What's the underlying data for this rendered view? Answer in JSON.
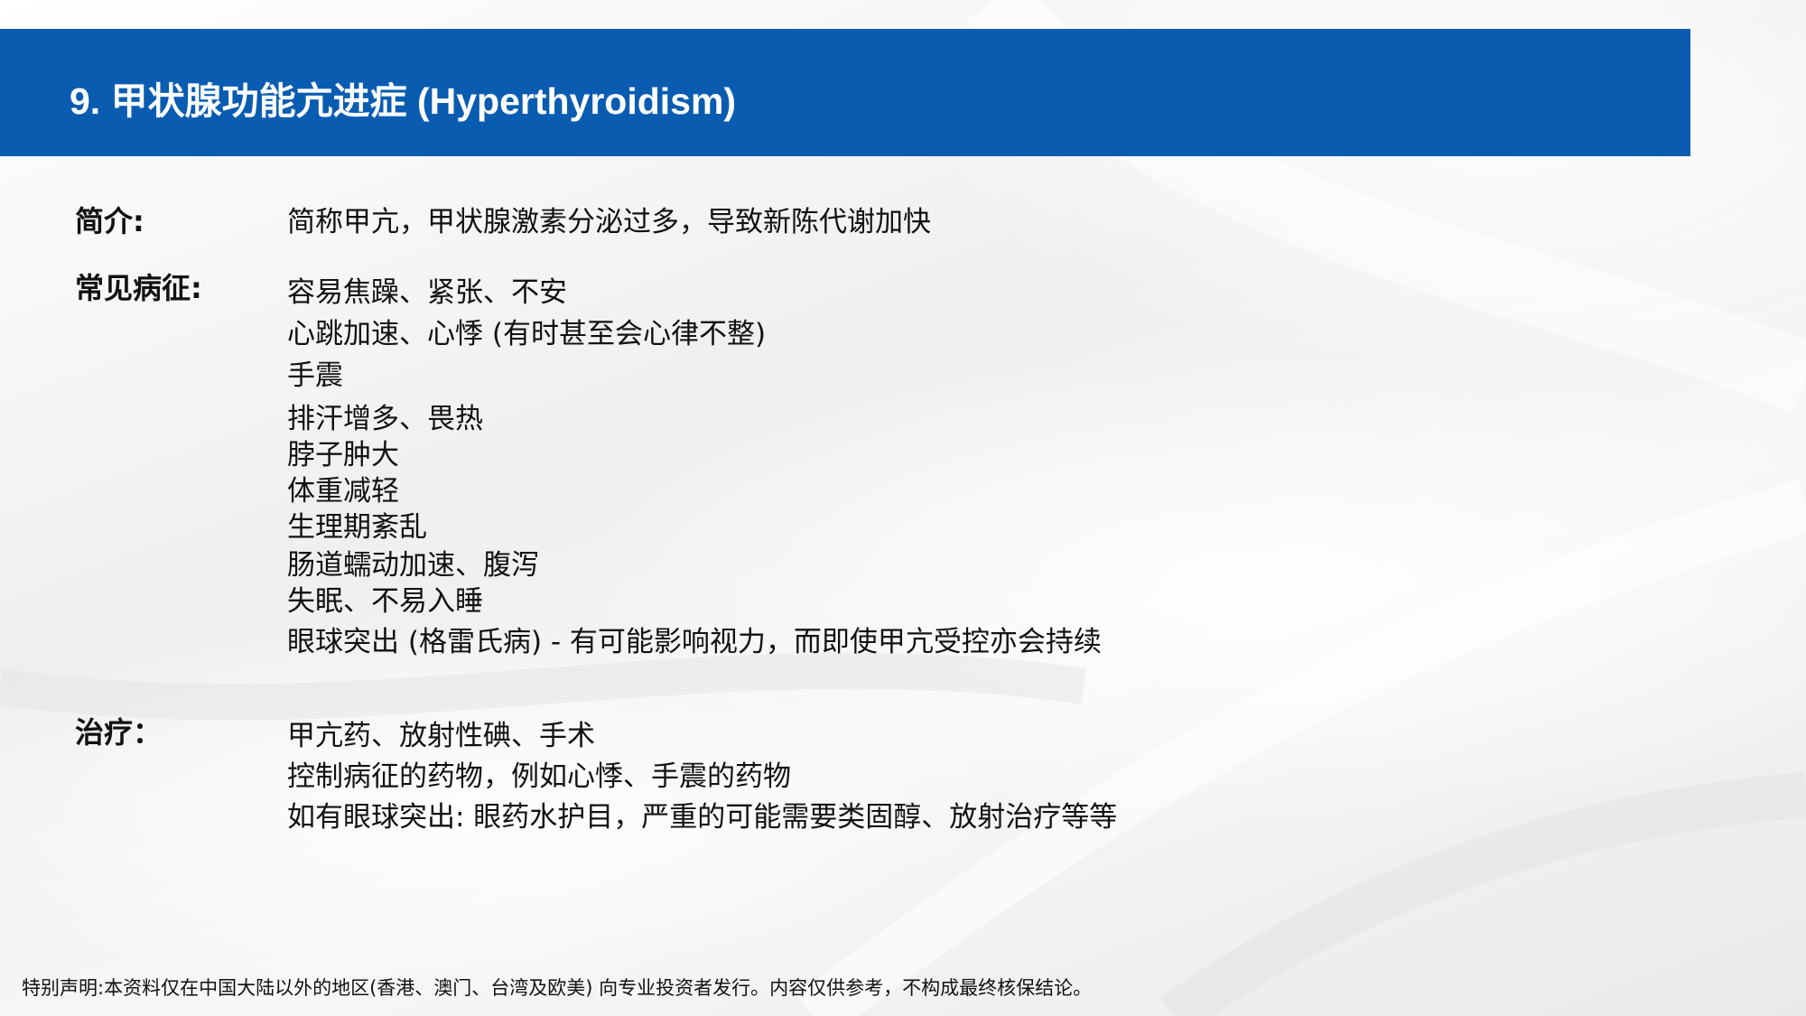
{
  "slide": {
    "title": "9. 甲状腺功能亢进症 (Hyperthyroidism)",
    "intro": {
      "label": "简介:",
      "text": "简称甲亢，甲状腺激素分泌过多，导致新陈代谢加快"
    },
    "symptoms": {
      "label": "常见病征:",
      "items": [
        "容易焦躁、紧张、不安",
        "心跳加速、心悸 (有时甚至会心律不整)",
        "手震",
        "排汗增多、畏热",
        "脖子肿大",
        "体重减轻",
        "生理期紊乱",
        "肠道蠕动加速、腹泻",
        "失眠、不易入睡",
        "眼球突出 (格雷氏病) - 有可能影响视力，而即使甲亢受控亦会持续"
      ]
    },
    "treatment": {
      "label": "治疗：",
      "items": [
        "甲亢药、放射性碘、手术",
        "控制病征的药物，例如心悸、手震的药物",
        "如有眼球突出: 眼药水护目，严重的可能需要类固醇、放射治疗等等"
      ]
    },
    "disclaimer": "特别声明:本资料仅在中国大陆以外的地区(香港、澳门、台湾及欧美) 向专业投资者发行。内容仅供参考，不构成最终核保结论。"
  },
  "colors": {
    "title_bar": "#0a5cb1",
    "title_text": "#ffffff",
    "body_text": "#111111"
  }
}
